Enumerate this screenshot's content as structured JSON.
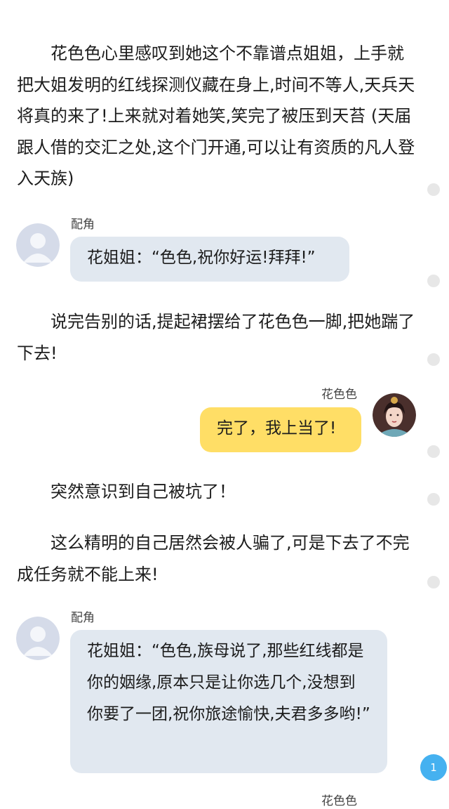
{
  "paragraphs": [
    "花色色心里感叹到她这个不靠谱点姐姐，上手就把大姐发明的红线探测仪藏在身上,时间不等人,天兵天将真的来了!上来就对着她笑,笑完了被压到天苔 (天届跟人借的交汇之处,这个门开通,可以让有资质的凡人登入天族)",
    "说完告别的话,提起裙摆给了花色色一脚,把她踹了下去!",
    "突然意识到自己被坑了！",
    "这么精明的自己居然会被人骗了,可是下去了不完成任务就不能上来!"
  ],
  "messages": [
    {
      "speaker": "配角",
      "text": "花姐姐：“色色,祝你好运!拜拜!”"
    },
    {
      "speaker": "花色色",
      "text": "完了，我上当了!"
    },
    {
      "speaker": "配角",
      "text": "花姐姐：“色色,族母说了,那些红线都是你的姻缘,原本只是让你选几个,没想到你要了一团,祝你旅途愉快,夫君多多哟!”"
    },
    {
      "speaker": "花色色"
    }
  ],
  "page_badge": "1",
  "colors": {
    "left_bubble": "#e1e8f0",
    "right_bubble": "#ffde66",
    "badge": "#45b1f0"
  },
  "icons": {
    "default_avatar": "person-silhouette",
    "character_avatar": "character-portrait"
  }
}
